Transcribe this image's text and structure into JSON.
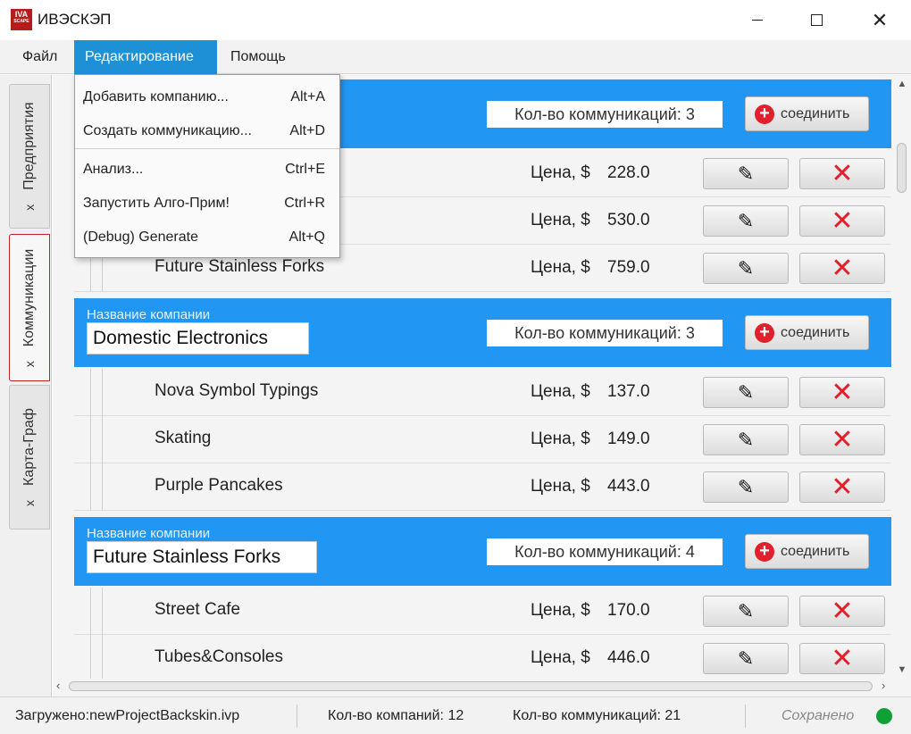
{
  "window": {
    "logo_text": "IVA",
    "logo_subtext": "SCAPE",
    "title": "ИВЭСКЭП"
  },
  "menubar": {
    "file": "Файл",
    "edit": "Редактирование",
    "help": "Помощь"
  },
  "edit_menu": [
    {
      "label": "Добавить компанию...",
      "shortcut": "Alt+A"
    },
    {
      "label": "Создать коммуникацию...",
      "shortcut": "Alt+D"
    },
    {
      "label": "Анализ...",
      "shortcut": "Ctrl+E"
    },
    {
      "label": "Запустить Алго-Прим!",
      "shortcut": "Ctrl+R"
    },
    {
      "label": "(Debug) Generate",
      "shortcut": "Alt+Q"
    }
  ],
  "tabs": [
    {
      "label": "Предприятия",
      "close": "x"
    },
    {
      "label": "Коммуникации",
      "close": "x"
    },
    {
      "label": "Карта-Граф",
      "close": "x"
    }
  ],
  "companies": [
    {
      "label": "",
      "name": "",
      "count": "Кол-во коммуникаций: 3",
      "connect": "соединить",
      "rows": [
        {
          "name": "",
          "price_label": "Цена, $",
          "price": "228.0"
        },
        {
          "name": "",
          "price_label": "Цена, $",
          "price": "530.0"
        },
        {
          "name": "Future Stainless Forks",
          "price_label": "Цена, $",
          "price": "759.0"
        }
      ]
    },
    {
      "label": "Название компании",
      "name": "Domestic Electronics",
      "count": "Кол-во коммуникаций: 3",
      "connect": "соединить",
      "rows": [
        {
          "name": "Nova Symbol Typings",
          "price_label": "Цена, $",
          "price": "137.0"
        },
        {
          "name": "Skating",
          "price_label": "Цена, $",
          "price": "149.0"
        },
        {
          "name": "Purple Pancakes",
          "price_label": "Цена, $",
          "price": "443.0"
        }
      ]
    },
    {
      "label": "Название компании",
      "name": "Future Stainless Forks",
      "count": "Кол-во коммуникаций: 4",
      "connect": "соединить",
      "rows": [
        {
          "name": "Street Cafe",
          "price_label": "Цена, $",
          "price": "170.0"
        },
        {
          "name": "Tubes&Consoles",
          "price_label": "Цена, $",
          "price": "446.0"
        }
      ]
    }
  ],
  "status": {
    "loaded": "Загружено:newProjectBackskin.ivp",
    "companies": "Кол-во компаний: 12",
    "communications": "Кол-во коммуникаций: 21",
    "saved": "Сохранено",
    "saved_color": "#11a036"
  },
  "colors": {
    "accent": "#2196f3",
    "menu_active": "#1e90d6",
    "delete": "#e0202c"
  }
}
